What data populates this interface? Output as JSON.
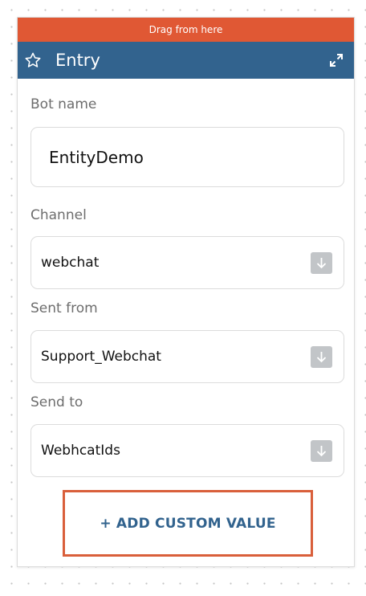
{
  "node": {
    "drag_label": "Drag from here",
    "title": "Entry",
    "title_icon": "star-icon",
    "expand_icon": "expand-icon",
    "colors": {
      "drag_bar": "#e05834",
      "header": "#32638e",
      "add_button_border": "#d95f3b",
      "add_button_text": "#32638e",
      "dropdown_button": "#c2c5c8"
    }
  },
  "fields": {
    "bot_name": {
      "label": "Bot name",
      "value": "EntityDemo"
    },
    "channel": {
      "label": "Channel",
      "value": "webchat",
      "icon": "arrow-down-icon"
    },
    "sent_from": {
      "label": "Sent from",
      "value": "Support_Webchat",
      "icon": "arrow-down-icon"
    },
    "send_to": {
      "label": "Send to",
      "value": "WebhcatIds",
      "icon": "arrow-down-icon"
    }
  },
  "add_custom_value": {
    "label": "+ ADD CUSTOM VALUE"
  }
}
